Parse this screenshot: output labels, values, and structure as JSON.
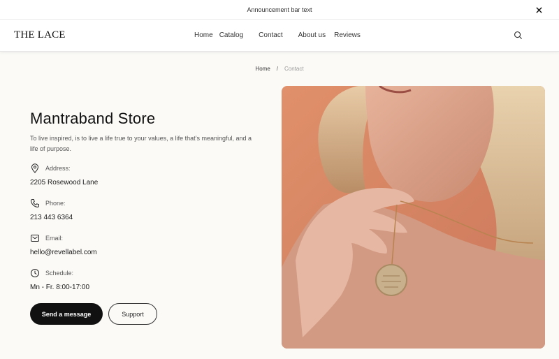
{
  "announcement": {
    "text": "Announcement bar text",
    "close_icon": "close-icon"
  },
  "header": {
    "logo": "THE LACE",
    "nav": [
      "Home",
      "Catalog",
      "Contact",
      "About us",
      "Reviews"
    ],
    "search_icon": "search-icon"
  },
  "breadcrumb": {
    "home": "Home",
    "separator": "/",
    "current": "Contact"
  },
  "store": {
    "title": "Mantraband Store",
    "description": "To live inspired, is to live a life true to your values, a life that’s meaningful, and a life of purpose."
  },
  "contact": {
    "address_label": "Address:",
    "address": "2205 Rosewood Lane",
    "phone_label": "Phone:",
    "phone": "213 443 6364",
    "email_label": "Email:",
    "email": "hello@revellabel.com",
    "schedule_label": "Schedule:",
    "schedule": "Mn - Fr. 8:00-17:00"
  },
  "buttons": {
    "primary": "Send a message",
    "secondary": "Support"
  },
  "colors": {
    "background": "#fbfaf7",
    "button_dark": "#111111",
    "photo_backdrop": "#d88a66"
  }
}
